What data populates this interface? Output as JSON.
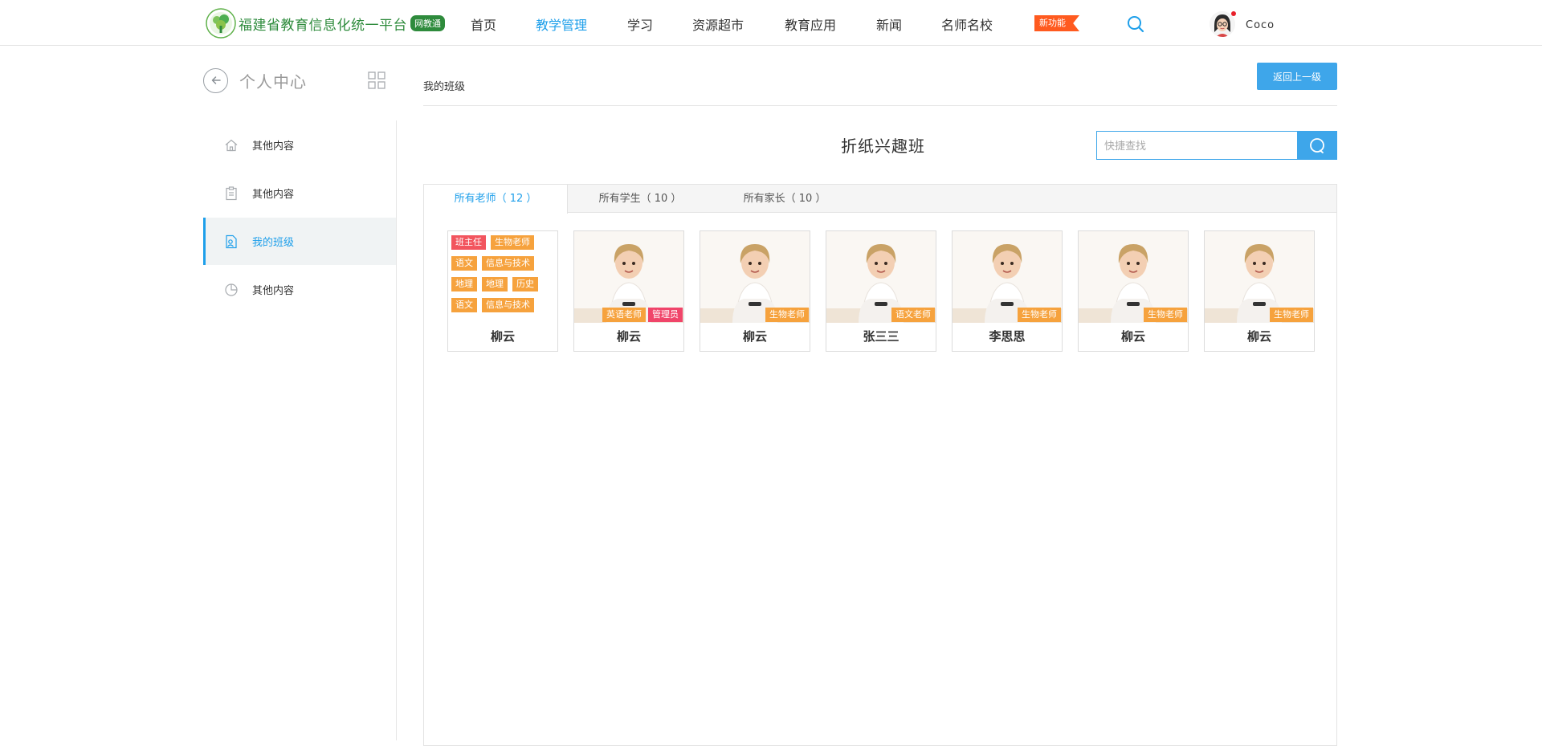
{
  "header": {
    "logo_text": "福建省教育信息化统一平台",
    "logo_badge": "网教通",
    "nav": [
      "首页",
      "教学管理",
      "学习",
      "资源超市",
      "教育应用",
      "新闻",
      "名师名校"
    ],
    "active_nav": "教学管理",
    "new_feature": "新功能",
    "username": "Coco"
  },
  "sidebar": {
    "title": "个人中心",
    "items": [
      {
        "label": "其他内容",
        "icon": "home-icon"
      },
      {
        "label": "其他内容",
        "icon": "clipboard-icon"
      },
      {
        "label": "我的班级",
        "icon": "class-icon",
        "active": true
      },
      {
        "label": "其他内容",
        "icon": "pie-chart-icon"
      }
    ]
  },
  "main": {
    "breadcrumb": "我的班级",
    "back_button": "返回上一级",
    "class_title": "折纸兴趣班",
    "search_placeholder": "快捷查找",
    "tabs": [
      {
        "label": "所有老师（ 12 ）",
        "active": true
      },
      {
        "label": "所有学生（ 10 ）"
      },
      {
        "label": "所有家长（ 10 ）"
      }
    ],
    "teachers": [
      {
        "name": "柳云",
        "tags": [
          "班主任",
          "生物老师",
          "语文",
          "信息与技术",
          "地理",
          "地理",
          "历史",
          "语文",
          "信息与技术"
        ],
        "photo": false
      },
      {
        "name": "柳云",
        "tags": [
          "英语老师",
          "管理员"
        ],
        "photo": true
      },
      {
        "name": "柳云",
        "tags": [
          "生物老师"
        ],
        "photo": true
      },
      {
        "name": "张三三",
        "tags": [
          "语文老师"
        ],
        "photo": true
      },
      {
        "name": "李思思",
        "tags": [
          "生物老师"
        ],
        "photo": true
      },
      {
        "name": "柳云",
        "tags": [
          "生物老师"
        ],
        "photo": true
      },
      {
        "name": "柳云",
        "tags": [
          "生物老师"
        ],
        "photo": true
      }
    ]
  },
  "colors": {
    "accent": "#1e9fea",
    "button": "#3ea6ea",
    "tag": "#f6a23d",
    "tag_red": "#f2555e",
    "tag_pink": "#f0456a",
    "brand_green": "#2e8b3c",
    "new_flag": "#ff5a1f"
  }
}
